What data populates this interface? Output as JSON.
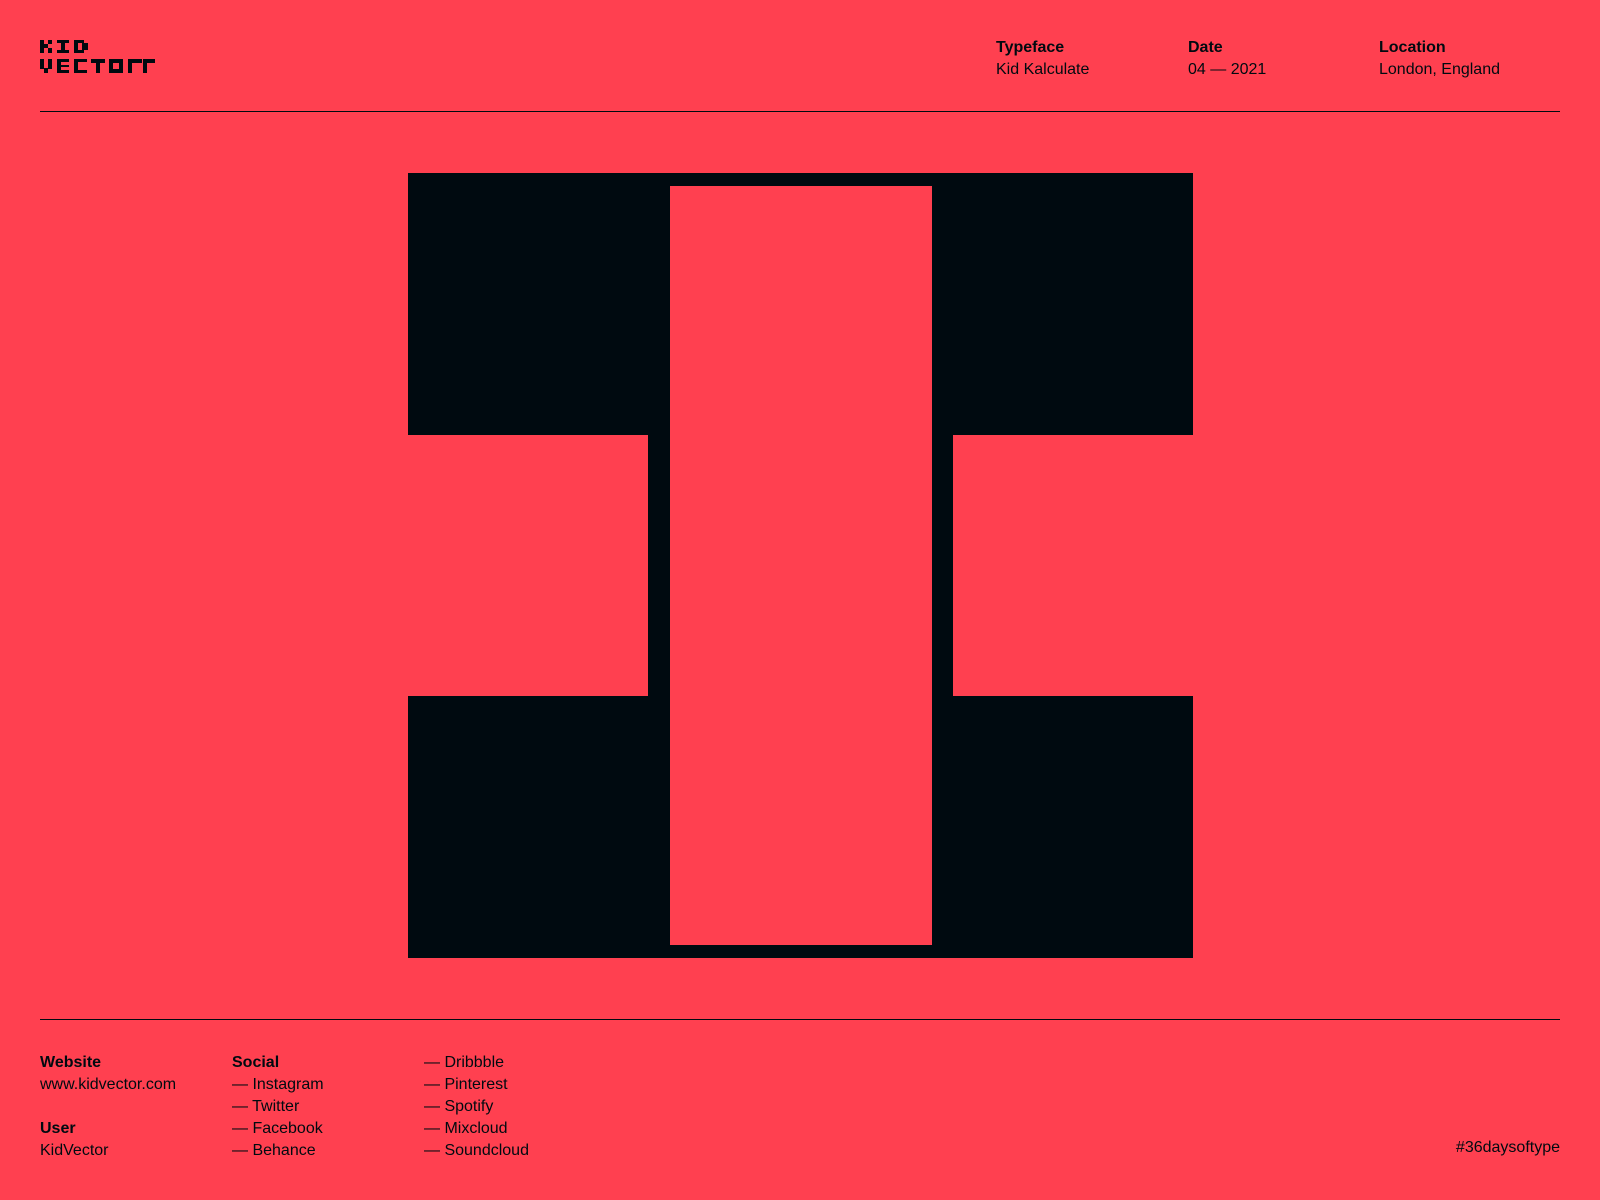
{
  "brand": {
    "logo_text": "KID VECTOR",
    "icon": "kidvector-pixel-logo"
  },
  "colors": {
    "background": "#ff4050",
    "ink": "#000a10"
  },
  "meta": {
    "typeface": {
      "label": "Typeface",
      "value": "Kid Kalculate"
    },
    "date": {
      "label": "Date",
      "value": "04 — 2021"
    },
    "location": {
      "label": "Location",
      "value": "London, England"
    }
  },
  "artwork": {
    "glyph": "I",
    "description_icon": "letter-i-glyph-artwork"
  },
  "footer": {
    "website": {
      "label": "Website",
      "value": "www.kidvector.com"
    },
    "user": {
      "label": "User",
      "value": "KidVector"
    },
    "social": {
      "label": "Social",
      "links_col1": [
        "— Instagram",
        "— Twitter",
        "— Facebook",
        "— Behance"
      ],
      "links_col2": [
        "— Dribbble",
        "— Pinterest",
        "— Spotify",
        "— Mixcloud",
        "— Soundcloud"
      ]
    },
    "hashtag": "#36daysoftype"
  }
}
